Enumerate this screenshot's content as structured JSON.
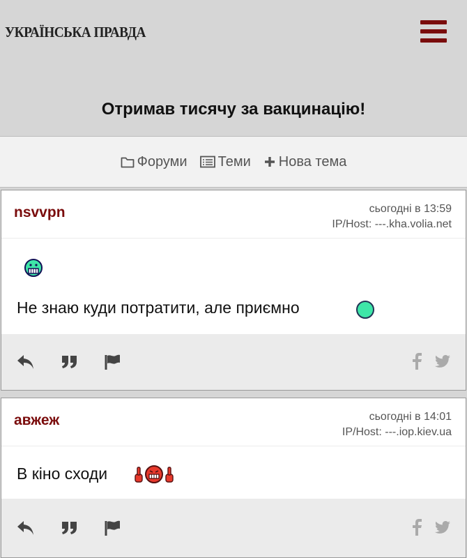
{
  "header": {
    "logo_text": "УКРАЇНСЬКА ПРАВДА",
    "menu_icon": "hamburger-menu-icon",
    "accent_color": "#7a0c0c"
  },
  "page_title": "Отримав тисячу за вакцинацію!",
  "nav": {
    "forums_label": "Форуми",
    "topics_label": "Теми",
    "new_topic_label": "Нова тема"
  },
  "posts": [
    {
      "author": "nsvvpn",
      "time": "сьогодні в 13:59",
      "host": "IP/Host: ---.kha.volia.net",
      "text": "Не знаю куди потратити, але приємно",
      "emojis": [
        "grinning-emoji",
        "green-circle-emoji"
      ]
    },
    {
      "author": "авжеж",
      "time": "сьогодні в 14:01",
      "host": "IP/Host: ---.iop.kiev.ua",
      "text": "В кіно сходи",
      "emojis": [
        "middle-finger-grin-emoji"
      ]
    }
  ],
  "post_actions": [
    "reply-icon",
    "quote-icon",
    "flag-icon",
    "facebook-icon",
    "twitter-icon"
  ]
}
